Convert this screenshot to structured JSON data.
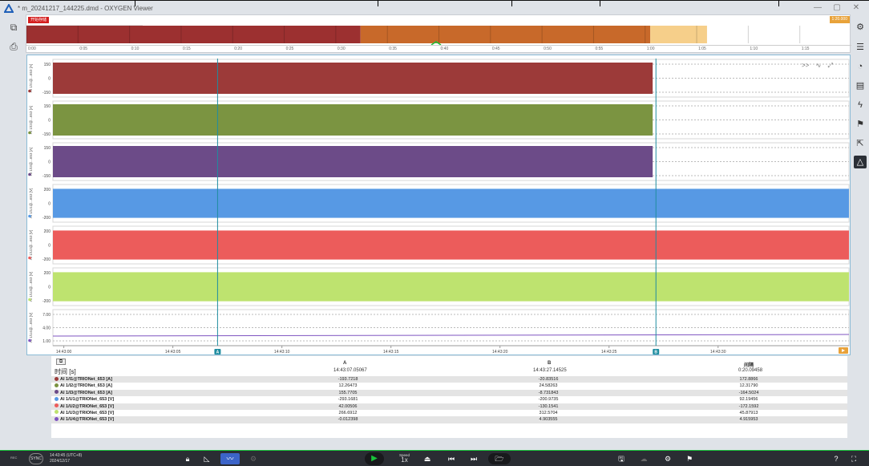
{
  "window": {
    "title": "* m_20241217_144225.dmd - OXYGEN Viewer",
    "controls": {
      "minimize": "—",
      "maximize": "▢",
      "close": "✕"
    },
    "accent": "#19c23a"
  },
  "overview": {
    "badge": "开始存储",
    "end_badge": "1:20.000",
    "tick_labels": [
      "0:00",
      "0:05",
      "0:10",
      "0:15",
      "0:20",
      "0:25",
      "0:30",
      "0:35",
      "0:40",
      "0:45",
      "0:50",
      "0:55",
      "1:00",
      "1:05",
      "1:10",
      "1:15"
    ],
    "segments": [
      {
        "from": 0,
        "to": 32.4,
        "color": "#9c3030"
      },
      {
        "from": 32.4,
        "to": 60.5,
        "color": "#c8692a"
      },
      {
        "from": 60.5,
        "to": 66.0,
        "color": "#f6cf8a"
      }
    ],
    "total_seconds": 80
  },
  "chart_data": {
    "type": "line",
    "x_tick_labels": [
      "14:43:00",
      "14:43:05",
      "14:43:10",
      "14:43:15",
      "14:43:20",
      "14:43:25",
      "14:43:30"
    ],
    "cursor_a": {
      "label": "A",
      "time": "14:43:07.05067"
    },
    "cursor_b": {
      "label": "B",
      "time": "14:43:27.14525"
    },
    "series": [
      {
        "name": "AI 1/I1@TRIONet_653 [A]",
        "axis_label": "AI 1/I1@...653 [A]",
        "color": "#9c3a39",
        "ticks": [
          "150",
          "0",
          "-150"
        ],
        "amplitude": 150
      },
      {
        "name": "AI 1/I2@TRIONet_653 [A]",
        "axis_label": "AI 1/I2@...653 [A]",
        "color": "#7b9441",
        "ticks": [
          "150",
          "0",
          "-150"
        ],
        "amplitude": 150
      },
      {
        "name": "AI 1/I3@TRIONet_653 [A]",
        "axis_label": "AI 1/I3@...653 [A]",
        "color": "#6c4b88",
        "ticks": [
          "150",
          "0",
          "-150"
        ],
        "amplitude": 150
      },
      {
        "name": "AI 1/U1@TRIONet_653 [V]",
        "axis_label": "AI 1/U1@...653 [V]",
        "color": "#5799e4",
        "ticks": [
          "200",
          "0",
          "-200"
        ],
        "amplitude": 230
      },
      {
        "name": "AI 1/U2@TRIONet_653 [V]",
        "axis_label": "AI 1/U2@...653 [V]",
        "color": "#ec5c5b",
        "ticks": [
          "200",
          "0",
          "-200"
        ],
        "amplitude": 230
      },
      {
        "name": "AI 1/U3@TRIONet_653 [V]",
        "axis_label": "AI 1/U3@...653 [V]",
        "color": "#bee36f",
        "ticks": [
          "200",
          "0",
          "-200"
        ],
        "amplitude": 230
      },
      {
        "name": "AI 1/U4@TRIONet_653 [V]",
        "axis_label": "AI 1/U4@...653 [V]",
        "color": "#7f55c1",
        "ticks": [
          "7.00",
          "4.00",
          "1.00"
        ],
        "amplitude": 0
      }
    ]
  },
  "chart_controls": {
    "expand": ">>",
    "wave": "∿",
    "fit": "⤢"
  },
  "cursor_panel": {
    "time_label": "时间 [s]",
    "col_a": {
      "header": "A",
      "time": "14:43:07.05067"
    },
    "col_b": {
      "header": "B",
      "time": "14:43:27.14525"
    },
    "col_d": {
      "header": "间隔",
      "time": "0:20.09458"
    },
    "rows": [
      {
        "channel": "AI 1/I1@TRIONet_653 [A]",
        "color": "#9c3a39",
        "a": "-193.7218",
        "b": "-20.83516",
        "d": "172.8866"
      },
      {
        "channel": "AI 1/I2@TRIONet_653 [A]",
        "color": "#7b9441",
        "a": "12.26473",
        "b": "24.58263",
        "d": "12.31790"
      },
      {
        "channel": "AI 1/I3@TRIONet_653 [A]",
        "color": "#6c4b88",
        "a": "155.7705",
        "b": "-8.731843",
        "d": "-164.5024"
      },
      {
        "channel": "AI 1/U1@TRIONet_653 [V]",
        "color": "#5799e4",
        "a": "-293.1681",
        "b": "-200.9735",
        "d": "92.19456"
      },
      {
        "channel": "AI 1/U2@TRIONet_653 [V]",
        "color": "#ec5c5b",
        "a": "42.00506",
        "b": "-130.1541",
        "d": "-172.1592"
      },
      {
        "channel": "AI 1/U3@TRIONet_653 [V]",
        "color": "#bee36f",
        "a": "266.6912",
        "b": "312.5704",
        "d": "45.87913"
      },
      {
        "channel": "AI 1/U4@TRIONet_653 [V]",
        "color": "#7f55c1",
        "a": "-0.012398",
        "b": "4.903555",
        "d": "4.915953"
      }
    ]
  },
  "left_tools": [
    "display-settings-icon",
    "print-icon"
  ],
  "right_tools": [
    "gear-icon",
    "list-icon",
    "gauge-icon",
    "report-icon",
    "lightning-icon",
    "flag-icon",
    "export-icon",
    "delta-icon"
  ],
  "bottom": {
    "rec": "REC",
    "sync": "SYNC",
    "time": "14:43:45 (UTC+8)",
    "date": "2024/12/17",
    "speed_label": "Speed",
    "speed_value": "1x"
  }
}
